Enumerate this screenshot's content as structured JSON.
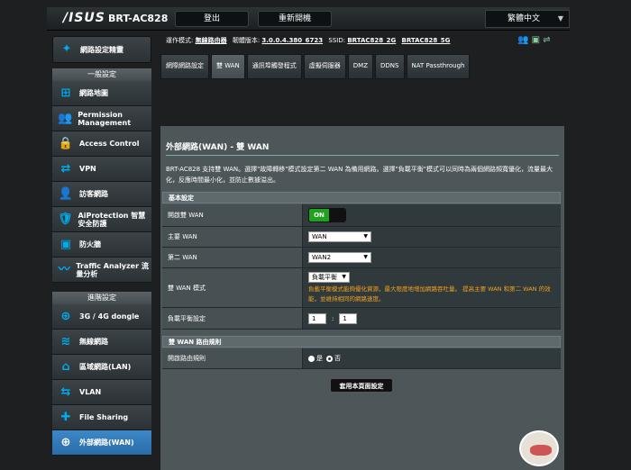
{
  "header": {
    "brand": "/ISUS",
    "model": "BRT-AC828",
    "logout_label": "登出",
    "reboot_label": "重新開機",
    "language": "繁體中文"
  },
  "info": {
    "op_mode_label": "運作模式:",
    "op_mode": "無線路由器",
    "firmware_label": "韌體版本:",
    "firmware": "3.0.0.4.380_6723",
    "ssid_label": "SSID:",
    "ssid_2g": "BRTAC828_2G",
    "ssid_5g": "BRTAC828_5G"
  },
  "sidebar": {
    "setup": "網路設定精靈",
    "general_header": "一般設定",
    "general_items": [
      {
        "label": "網路地圖",
        "icon": "network-map-icon"
      },
      {
        "label": "Permission Management",
        "icon": "users-icon"
      },
      {
        "label": "Access Control",
        "icon": "lock-icon"
      },
      {
        "label": "VPN",
        "icon": "vpn-icon"
      },
      {
        "label": "訪客網路",
        "icon": "guest-icon"
      },
      {
        "label": "AiProtection 智慧安全防護",
        "icon": "shield-lock-icon"
      },
      {
        "label": "防火牆",
        "icon": "firewall-icon"
      },
      {
        "label": "Traffic Analyzer 流量分析",
        "icon": "traffic-icon"
      }
    ],
    "advanced_header": "進階設定",
    "advanced_items": [
      {
        "label": "3G / 4G dongle",
        "icon": "globe-icon"
      },
      {
        "label": "無線網路",
        "icon": "wifi-icon"
      },
      {
        "label": "區域網路(LAN)",
        "icon": "home-icon"
      },
      {
        "label": "VLAN",
        "icon": "vlan-icon"
      },
      {
        "label": "File Sharing",
        "icon": "puzzle-icon"
      },
      {
        "label": "外部網路(WAN)",
        "icon": "wan-globe-icon"
      }
    ]
  },
  "tabs": [
    "網際網路設定",
    "雙 WAN",
    "通訊埠觸發程式",
    "虛擬伺服器",
    "DMZ",
    "DDNS",
    "NAT Passthrough"
  ],
  "main": {
    "title": "外部網路(WAN) - 雙 WAN",
    "description": "BRT-AC828 支持雙 WAN。選擇\"故障轉移\"模式設定第二 WAN 為備用網路。選擇\"負載平衡\"模式可以同時為兩個網路頻寬優化，流量最大化，反應時間最小化，並防止數據溢出。",
    "basic_header": "基本設定",
    "enable_dual_wan_label": "開啟雙 WAN",
    "enable_dual_wan_value": "ON",
    "primary_wan_label": "主要 WAN",
    "primary_wan_value": "WAN",
    "secondary_wan_label": "第二 WAN",
    "secondary_wan_value": "WAN2",
    "mode_label": "雙 WAN 模式",
    "mode_value": "負載平衡",
    "mode_note": "負載平衡模式能夠優化資源，最大限度地增加網路吞吐量。 提高主要 WAN 和第二 WAN 的效能，並維持相同的網路速度。",
    "lb_label": "負載平衡設定",
    "lb_value1": "1",
    "lb_sep": ":",
    "lb_value2": "1",
    "routing_header": "雙 WAN 路由規則",
    "routing_label": "開啟路由規則",
    "routing_yes": "是",
    "routing_no": "否",
    "apply_label": "套用本頁面設定"
  }
}
